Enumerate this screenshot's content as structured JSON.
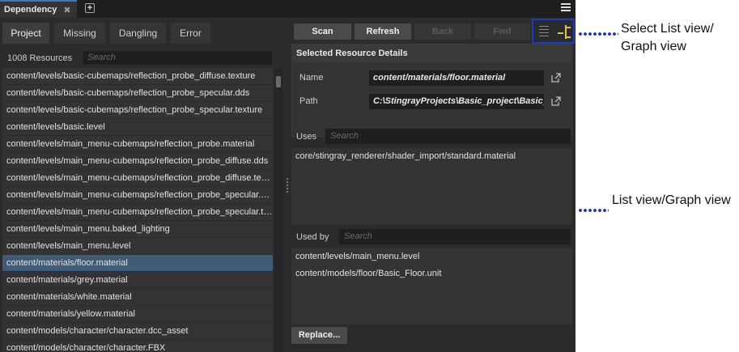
{
  "window": {
    "tab_title": "Dependency",
    "tab_close": "✖",
    "add_tab": "+"
  },
  "left": {
    "tabs": [
      "Project",
      "Missing",
      "Dangling",
      "Error"
    ],
    "resource_count": "1008 Resources",
    "search_placeholder": "Search",
    "items": [
      "content/levels/basic-cubemaps/reflection_probe_diffuse.texture",
      "content/levels/basic-cubemaps/reflection_probe_specular.dds",
      "content/levels/basic-cubemaps/reflection_probe_specular.texture",
      "content/levels/basic.level",
      "content/levels/main_menu-cubemaps/reflection_probe.material",
      "content/levels/main_menu-cubemaps/reflection_probe_diffuse.dds",
      "content/levels/main_menu-cubemaps/reflection_probe_diffuse.texture",
      "content/levels/main_menu-cubemaps/reflection_probe_specular.dds",
      "content/levels/main_menu-cubemaps/reflection_probe_specular.texture",
      "content/levels/main_menu.baked_lighting",
      "content/levels/main_menu.level",
      "content/materials/floor.material",
      "content/materials/grey.material",
      "content/materials/white.material",
      "content/materials/yellow.material",
      "content/models/character/character.dcc_asset",
      "content/models/character/character.FBX"
    ],
    "selected_item": "content/materials/floor.material"
  },
  "toolbar": {
    "scan": "Scan",
    "refresh": "Refresh",
    "back": "Back",
    "fwd": "Fwd"
  },
  "details": {
    "header": "Selected Resource Details",
    "name_label": "Name",
    "name_value": "content/materials/floor.material",
    "path_label": "Path",
    "path_value": "C:\\StingrayProjects\\Basic_project\\Basic_project\\content\\materials\\floor.material"
  },
  "uses": {
    "label": "Uses",
    "search_placeholder": "Search",
    "items": [
      "core/stingray_renderer/shader_import/standard.material"
    ]
  },
  "used_by": {
    "label": "Used by",
    "search_placeholder": "Search",
    "items": [
      "content/levels/main_menu.level",
      "content/models/floor/Basic_Floor.unit"
    ]
  },
  "replace_button": "Replace...",
  "annotations": {
    "view_select": "Select List view/ Graph view",
    "view_area": "List view/Graph view"
  },
  "colors": {
    "selection": "#3f5b78",
    "annotation_blue": "#1a2fc7",
    "graph_icon": "#e3c14a"
  }
}
